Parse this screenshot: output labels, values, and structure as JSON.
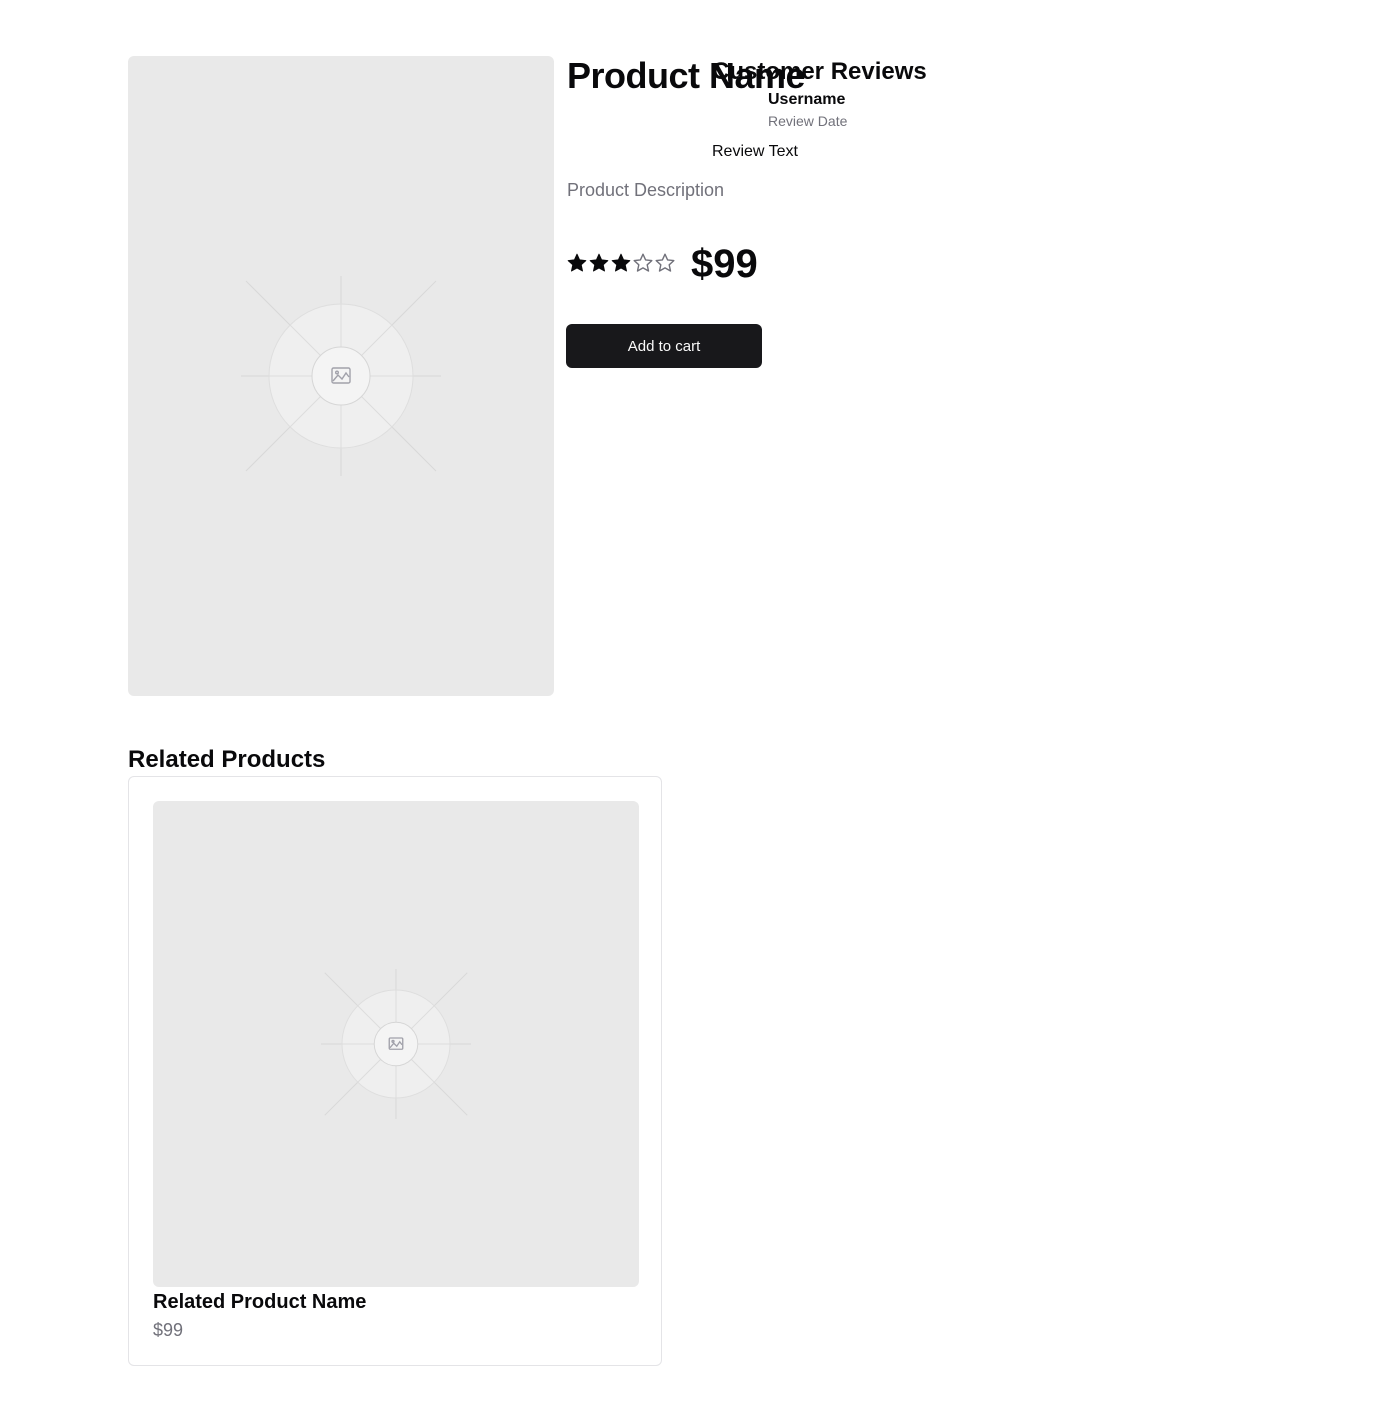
{
  "product": {
    "name": "Product Name",
    "description": "Product Description",
    "rating": 3,
    "rating_max": 5,
    "price": "$99",
    "add_to_cart_label": "Add to cart",
    "image_icon": "image-placeholder-icon"
  },
  "reviews": {
    "title": "Customer Reviews",
    "items": [
      {
        "username": "Username",
        "date": "Review Date",
        "text": "Review Text"
      }
    ]
  },
  "related": {
    "title": "Related Products",
    "items": [
      {
        "name": "Related Product Name",
        "price": "$99",
        "image_icon": "image-placeholder-icon"
      }
    ]
  },
  "colors": {
    "primary_button": "#18181b",
    "muted_text": "#71717a",
    "placeholder_bg": "#e9e9e9",
    "star_filled": "#09090b"
  }
}
